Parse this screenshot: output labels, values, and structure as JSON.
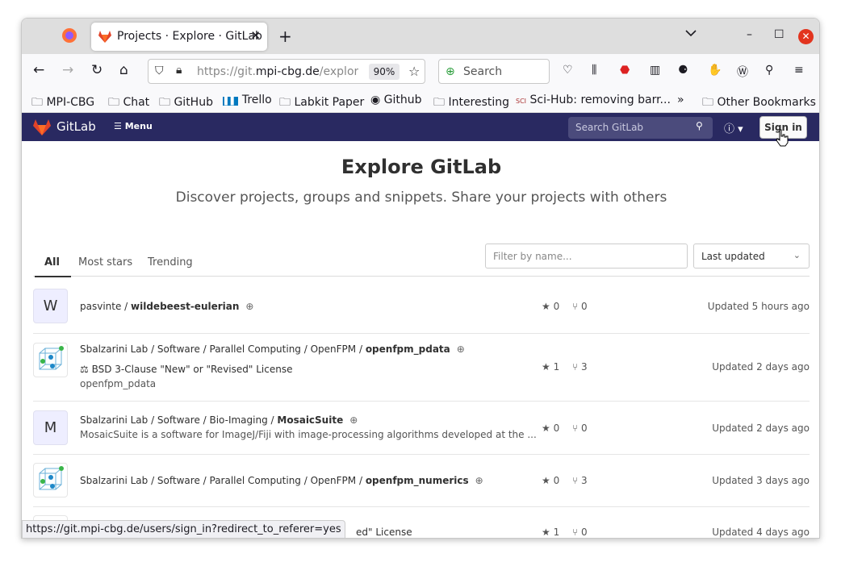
{
  "browser": {
    "tab_title": "Projects · Explore · GitLab",
    "url_prefix": "https://git.",
    "url_domain": "mpi-cbg.de",
    "url_suffix": "/explor",
    "zoom": "90%",
    "search_placeholder": "Search"
  },
  "bookmarks": [
    "MPI-CBG",
    "Chat",
    "GitHub",
    "Trello",
    "Labkit Paper",
    "Github",
    "Interesting",
    "Sci-Hub: removing barr...",
    "Other Bookmarks"
  ],
  "gitlab": {
    "brand": "GitLab",
    "menu": "Menu",
    "search_placeholder": "Search GitLab",
    "signin": "Sign in"
  },
  "page": {
    "title": "Explore GitLab",
    "subtitle": "Discover projects, groups and snippets. Share your projects with others",
    "tabs": [
      "All",
      "Most stars",
      "Trending"
    ],
    "filter_placeholder": "Filter by name...",
    "sort": "Last updated"
  },
  "projects": [
    {
      "avatar": "W",
      "path": "pasvinte / ",
      "name": "wildebeest-eulerian",
      "license": "",
      "desc": "",
      "stars": "0",
      "forks": "0",
      "updated": "Updated 5 hours ago"
    },
    {
      "avatar": "",
      "path": "Sbalzarini Lab / Software / Parallel Computing / OpenFPM / ",
      "name": "openfpm_pdata",
      "license": "BSD 3-Clause \"New\" or \"Revised\" License",
      "desc": "openfpm_pdata",
      "stars": "1",
      "forks": "3",
      "updated": "Updated 2 days ago"
    },
    {
      "avatar": "M",
      "path": "Sbalzarini Lab / Software / Bio-Imaging / ",
      "name": "MosaicSuite",
      "license": "",
      "desc": "MosaicSuite is a software for ImageJ/Fiji with image-processing algorithms developed at the ...",
      "stars": "0",
      "forks": "0",
      "updated": "Updated 2 days ago"
    },
    {
      "avatar": "",
      "path": "Sbalzarini Lab / Software / Parallel Computing / OpenFPM / ",
      "name": "openfpm_numerics",
      "license": "",
      "desc": "",
      "stars": "0",
      "forks": "3",
      "updated": "Updated 3 days ago"
    },
    {
      "avatar": "",
      "path": "",
      "name": "",
      "license": "ed\" License",
      "desc": "",
      "stars": "1",
      "forks": "0",
      "updated": "Updated 4 days ago"
    }
  ],
  "status_url": "https://git.mpi-cbg.de/users/sign_in?redirect_to_referer=yes"
}
